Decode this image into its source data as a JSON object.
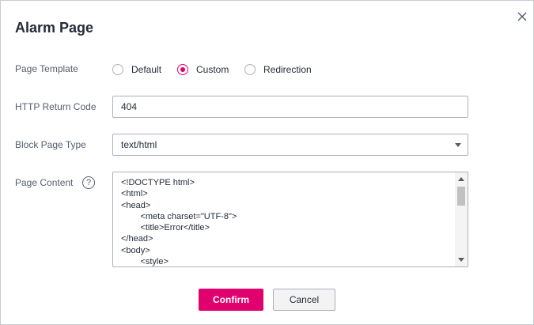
{
  "dialog": {
    "title": "Alarm Page",
    "close_icon": "close-icon"
  },
  "form": {
    "page_template": {
      "label": "Page Template",
      "options": [
        "Default",
        "Custom",
        "Redirection"
      ],
      "selected": "Custom"
    },
    "http_return_code": {
      "label": "HTTP Return Code",
      "value": "404"
    },
    "block_page_type": {
      "label": "Block Page Type",
      "value": "text/html"
    },
    "page_content": {
      "label": "Page Content",
      "help_icon": "question-icon",
      "value": "<!DOCTYPE html>\n<html>\n<head>\n        <meta charset=\"UTF-8\">\n        <title>Error</title>\n</head>\n<body>\n        <style>"
    }
  },
  "buttons": {
    "confirm": "Confirm",
    "cancel": "Cancel"
  },
  "colors": {
    "accent": "#e0006e",
    "text": "#252b3a",
    "border": "#adb0b8"
  }
}
